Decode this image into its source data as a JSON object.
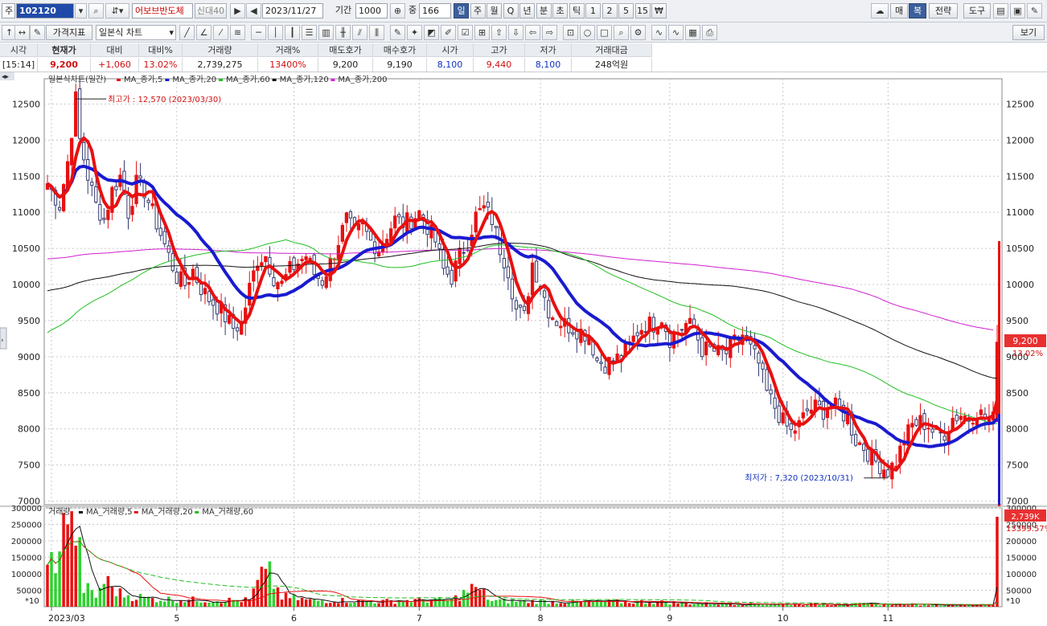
{
  "toolbar": {
    "market": "주",
    "code": "102120",
    "stock_name": "어보브반도체",
    "badge": "신대40",
    "date": "2023/11/27",
    "period_label": "기간",
    "period_value": "1000",
    "count_label": "중",
    "count_value": "166",
    "timeframes": [
      "일",
      "주",
      "월",
      "Q",
      "년",
      "분",
      "초",
      "틱",
      "1",
      "2",
      "5",
      "15",
      "₩"
    ],
    "right_buttons": [
      "매",
      "복",
      "전략",
      "도구"
    ]
  },
  "toolbar2": {
    "indicator_button": "가격지표",
    "chart_type": "일본식 차트",
    "view_button": "보기"
  },
  "quote": {
    "headers": [
      "시각",
      "현재가",
      "대비",
      "대비%",
      "거래량",
      "거래%",
      "매도호가",
      "매수호가",
      "시가",
      "고가",
      "저가",
      "거래대금"
    ],
    "values": [
      "[15:14]",
      "9,200",
      "+1,060",
      "13.02%",
      "2,739,275",
      "13400%",
      "9,200",
      "9,190",
      "8,100",
      "9,440",
      "8,100",
      "248억원"
    ],
    "colors": [
      "#222",
      "#d01010",
      "#d01010",
      "#d01010",
      "#222",
      "#d01010",
      "#222",
      "#222",
      "#1030c0",
      "#d01010",
      "#1030c0",
      "#222"
    ]
  },
  "price_legend": {
    "title": "일본식차트(일간)",
    "items": [
      {
        "label": "MA_종가,5",
        "color": "#e81010"
      },
      {
        "label": "MA_종가,20",
        "color": "#1a1ad0"
      },
      {
        "label": "MA_종가,60",
        "color": "#20c020"
      },
      {
        "label": "MA_종가,120",
        "color": "#111111"
      },
      {
        "label": "MA_종가,200",
        "color": "#e020e0"
      }
    ]
  },
  "volume_legend": {
    "title": "거래량",
    "items": [
      {
        "label": "MA_거래량,5",
        "color": "#111111"
      },
      {
        "label": "MA_거래량,20",
        "color": "#e81010"
      },
      {
        "label": "MA_거래량,60",
        "color": "#20c020"
      }
    ]
  },
  "annotations": {
    "high": "최고가 : 12,570 (2023/03/30)",
    "low": "최저가 : 7,320 (2023/10/31)",
    "last_price": "9,200",
    "last_pct": "13.02%",
    "last_volume": "2,739K",
    "last_volume_pct": "13399.57%",
    "volume_unit": "*10"
  },
  "chart_data": {
    "type": "candlestick",
    "price_axis": {
      "ticks": [
        7000,
        7500,
        8000,
        8500,
        9000,
        9500,
        10000,
        10500,
        11000,
        11500,
        12000,
        12500
      ],
      "range": [
        6950,
        12850
      ]
    },
    "volume_axis": {
      "ticks": [
        50000,
        100000,
        150000,
        200000,
        250000,
        300000
      ],
      "max_label": "300000",
      "range": [
        0,
        300000
      ]
    },
    "x_labels": [
      "2023/03",
      "5",
      "6",
      "7",
      "8",
      "9",
      "10",
      "11"
    ],
    "x_label_index": [
      1,
      32,
      61,
      92,
      122,
      154,
      182,
      208
    ],
    "price_anchors": [
      [
        0,
        11400
      ],
      [
        3,
        11100
      ],
      [
        5,
        11700
      ],
      [
        7,
        12570
      ],
      [
        8,
        12000
      ],
      [
        10,
        11500
      ],
      [
        12,
        11100
      ],
      [
        14,
        10900
      ],
      [
        16,
        11300
      ],
      [
        18,
        11500
      ],
      [
        20,
        11000
      ],
      [
        22,
        11400
      ],
      [
        24,
        11300
      ],
      [
        26,
        11000
      ],
      [
        28,
        10700
      ],
      [
        30,
        10400
      ],
      [
        32,
        10100
      ],
      [
        34,
        10000
      ],
      [
        36,
        10200
      ],
      [
        38,
        9950
      ],
      [
        40,
        9800
      ],
      [
        42,
        9700
      ],
      [
        44,
        9550
      ],
      [
        46,
        9400
      ],
      [
        48,
        9450
      ],
      [
        50,
        9950
      ],
      [
        52,
        10350
      ],
      [
        54,
        10400
      ],
      [
        56,
        10100
      ],
      [
        58,
        10000
      ],
      [
        60,
        10200
      ],
      [
        62,
        10300
      ],
      [
        64,
        10400
      ],
      [
        66,
        10150
      ],
      [
        68,
        10050
      ],
      [
        70,
        10300
      ],
      [
        72,
        10600
      ],
      [
        74,
        10900
      ],
      [
        76,
        10700
      ],
      [
        78,
        10800
      ],
      [
        80,
        10600
      ],
      [
        82,
        10500
      ],
      [
        84,
        10700
      ],
      [
        86,
        10900
      ],
      [
        88,
        10850
      ],
      [
        90,
        10900
      ],
      [
        92,
        11000
      ],
      [
        94,
        10800
      ],
      [
        96,
        10600
      ],
      [
        98,
        10200
      ],
      [
        100,
        10100
      ],
      [
        102,
        10400
      ],
      [
        104,
        10600
      ],
      [
        106,
        10950
      ],
      [
        108,
        11050
      ],
      [
        110,
        10900
      ],
      [
        112,
        10500
      ],
      [
        114,
        10200
      ],
      [
        116,
        9650
      ],
      [
        118,
        9550
      ],
      [
        120,
        10300
      ],
      [
        122,
        10000
      ],
      [
        124,
        9650
      ],
      [
        126,
        9500
      ],
      [
        128,
        9450
      ],
      [
        130,
        9400
      ],
      [
        132,
        9350
      ],
      [
        134,
        9300
      ],
      [
        136,
        8950
      ],
      [
        138,
        8900
      ],
      [
        140,
        8950
      ],
      [
        142,
        9000
      ],
      [
        144,
        9150
      ],
      [
        146,
        9350
      ],
      [
        148,
        9450
      ],
      [
        150,
        9450
      ],
      [
        152,
        9550
      ],
      [
        154,
        9250
      ],
      [
        156,
        9350
      ],
      [
        158,
        9450
      ],
      [
        160,
        9400
      ],
      [
        162,
        9100
      ],
      [
        164,
        9100
      ],
      [
        166,
        9050
      ],
      [
        168,
        9050
      ],
      [
        170,
        9200
      ],
      [
        172,
        9300
      ],
      [
        174,
        9100
      ],
      [
        176,
        8900
      ],
      [
        178,
        8500
      ],
      [
        180,
        8300
      ],
      [
        182,
        8100
      ],
      [
        184,
        7950
      ],
      [
        186,
        8050
      ],
      [
        188,
        8250
      ],
      [
        190,
        8300
      ],
      [
        192,
        8250
      ],
      [
        194,
        8350
      ],
      [
        196,
        8250
      ],
      [
        198,
        8150
      ],
      [
        200,
        7850
      ],
      [
        202,
        7750
      ],
      [
        204,
        7600
      ],
      [
        206,
        7500
      ],
      [
        208,
        7420
      ],
      [
        210,
        7550
      ],
      [
        212,
        7850
      ],
      [
        214,
        8050
      ],
      [
        216,
        8100
      ],
      [
        218,
        8050
      ],
      [
        220,
        7900
      ],
      [
        222,
        7950
      ],
      [
        224,
        8150
      ],
      [
        226,
        8200
      ],
      [
        228,
        8150
      ],
      [
        230,
        8250
      ],
      [
        232,
        8150
      ],
      [
        234,
        8130
      ],
      [
        235,
        9200
      ]
    ],
    "volume_anchors": [
      [
        0,
        100000
      ],
      [
        5,
        250000
      ],
      [
        6,
        290000
      ],
      [
        7,
        240000
      ],
      [
        9,
        60000
      ],
      [
        12,
        30000
      ],
      [
        14,
        80000
      ],
      [
        18,
        40000
      ],
      [
        25,
        25000
      ],
      [
        32,
        22000
      ],
      [
        40,
        20000
      ],
      [
        50,
        20000
      ],
      [
        54,
        115000
      ],
      [
        58,
        30000
      ],
      [
        66,
        18000
      ],
      [
        72,
        20000
      ],
      [
        80,
        15000
      ],
      [
        92,
        20000
      ],
      [
        100,
        20000
      ],
      [
        106,
        60000
      ],
      [
        110,
        18000
      ],
      [
        130,
        15000
      ],
      [
        150,
        15000
      ],
      [
        160,
        10000
      ],
      [
        180,
        8000
      ],
      [
        200,
        8000
      ],
      [
        215,
        7000
      ],
      [
        225,
        6000
      ],
      [
        234,
        5000
      ],
      [
        235,
        273000
      ]
    ],
    "ma_window_series": [
      5,
      20,
      60,
      120,
      200
    ],
    "grid": true
  }
}
